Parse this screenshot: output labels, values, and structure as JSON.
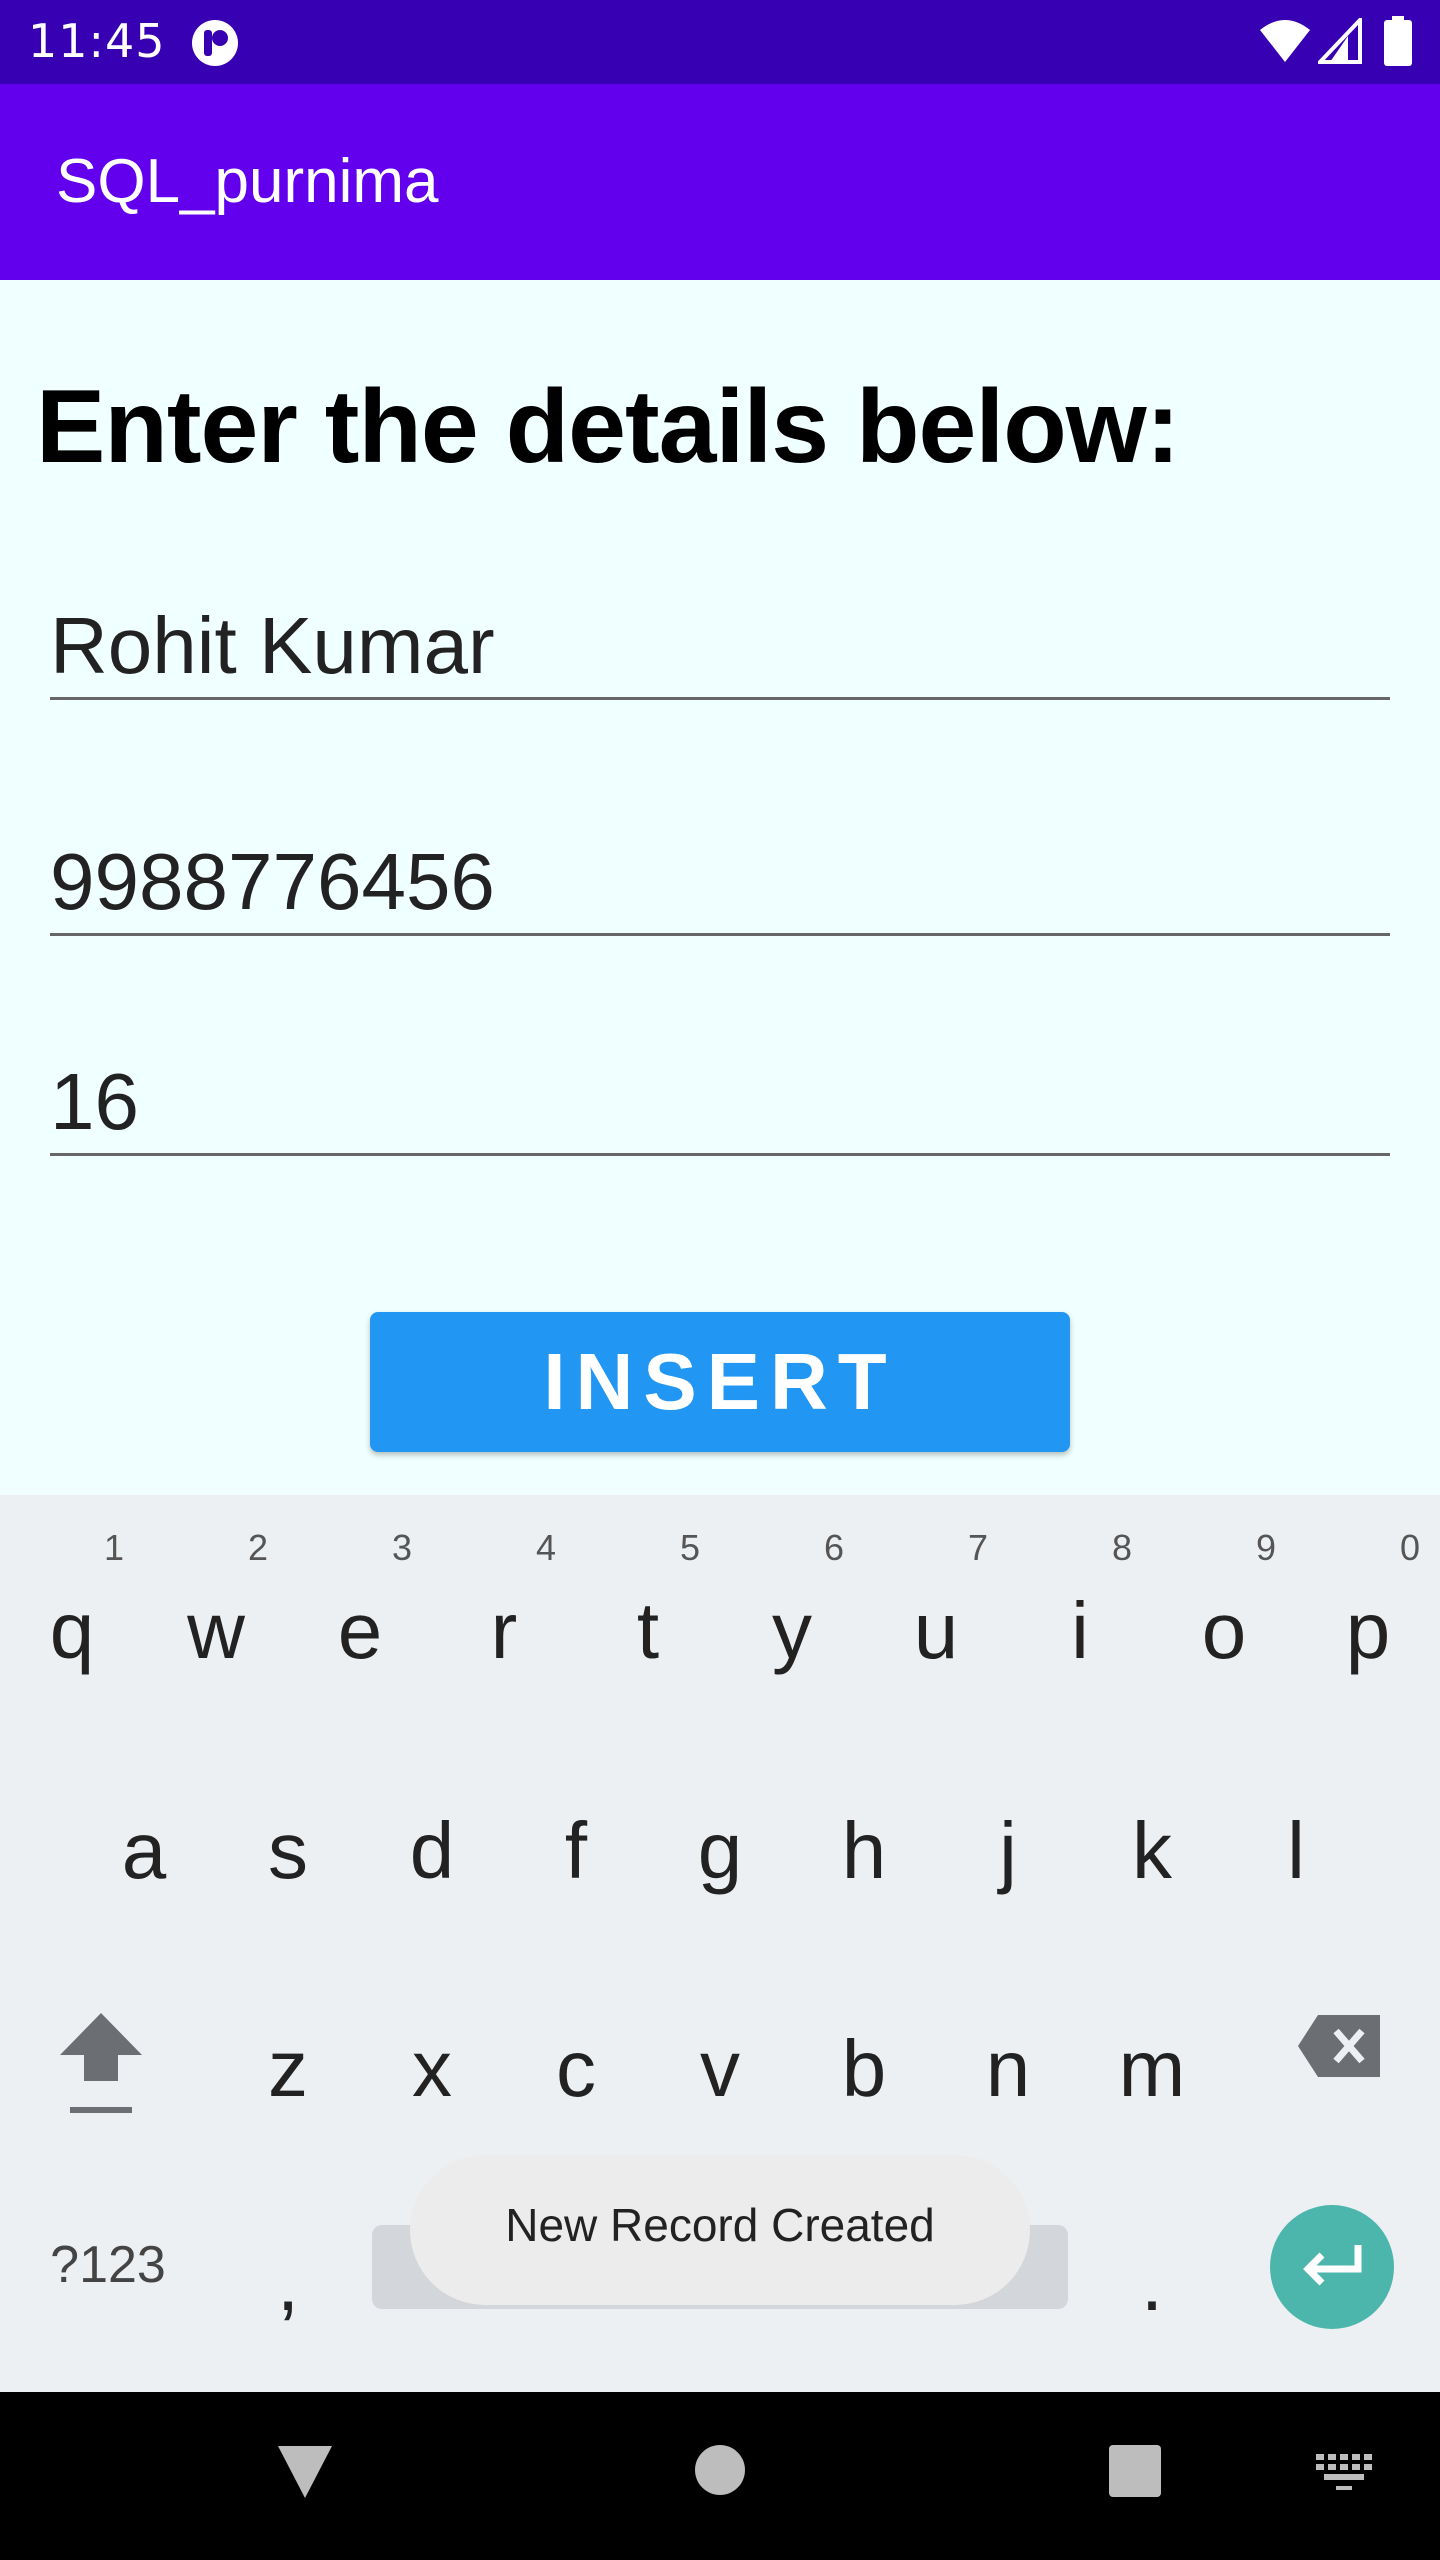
{
  "status_bar": {
    "time": "11:45"
  },
  "app_bar": {
    "title": "SQL_purnima"
  },
  "form": {
    "heading": "Enter the details below:",
    "name_value": "Rohit Kumar",
    "phone_value": "9988776456",
    "age_value": "16",
    "insert_label": "INSERT"
  },
  "keyboard": {
    "row1": [
      {
        "key": "q",
        "hint": "1"
      },
      {
        "key": "w",
        "hint": "2"
      },
      {
        "key": "e",
        "hint": "3"
      },
      {
        "key": "r",
        "hint": "4"
      },
      {
        "key": "t",
        "hint": "5"
      },
      {
        "key": "y",
        "hint": "6"
      },
      {
        "key": "u",
        "hint": "7"
      },
      {
        "key": "i",
        "hint": "8"
      },
      {
        "key": "o",
        "hint": "9"
      },
      {
        "key": "p",
        "hint": "0"
      }
    ],
    "row2": [
      "a",
      "s",
      "d",
      "f",
      "g",
      "h",
      "j",
      "k",
      "l"
    ],
    "row3": [
      "z",
      "x",
      "c",
      "v",
      "b",
      "n",
      "m"
    ],
    "symbols_label": "?123",
    "comma": ",",
    "period": "."
  },
  "toast": {
    "message": "New Record Created"
  },
  "colors": {
    "status_bar": "#3700B3",
    "app_bar": "#6200EE",
    "background": "#F0FFFF",
    "button": "#2196F3",
    "enter_key": "#4DB6AC"
  }
}
